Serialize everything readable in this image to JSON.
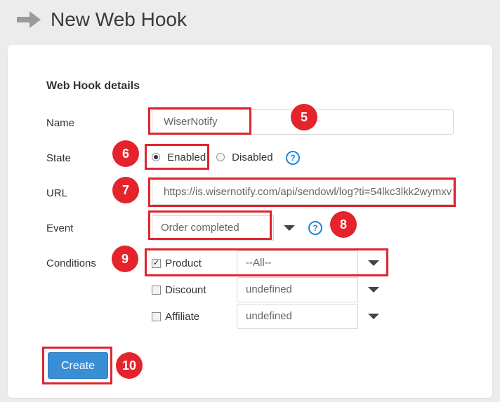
{
  "header": {
    "title": "New Web Hook",
    "arrow_icon": "right-arrow-icon"
  },
  "form": {
    "section_title": "Web Hook details",
    "name": {
      "label": "Name",
      "value": "WiserNotify"
    },
    "state": {
      "label": "State",
      "options": [
        "Enabled",
        "Disabled"
      ],
      "selected": "Enabled"
    },
    "url": {
      "label": "URL",
      "value": "https://is.wisernotify.com/api/sendowl/log?ti=54lkc3lkk2wymxv"
    },
    "event": {
      "label": "Event",
      "selected": "Order completed"
    },
    "conditions": {
      "label": "Conditions",
      "items": [
        {
          "label": "Product",
          "checked": true,
          "check_glyph": "✓",
          "select_value": "--All--"
        },
        {
          "label": "Discount",
          "checked": false,
          "check_glyph": "",
          "select_value": "undefined"
        },
        {
          "label": "Affiliate",
          "checked": false,
          "check_glyph": "",
          "select_value": "undefined"
        }
      ]
    },
    "help_icon_text": "?",
    "create_label": "Create"
  },
  "annotations": {
    "badge_5": "5",
    "badge_6": "6",
    "badge_7": "7",
    "badge_8": "8",
    "badge_9": "9",
    "badge_10": "10",
    "highlight_color": "#e0242e"
  },
  "colors": {
    "accent": "#3a8ed6",
    "help_blue": "#1e88d8",
    "badge_red": "#e4232b"
  }
}
